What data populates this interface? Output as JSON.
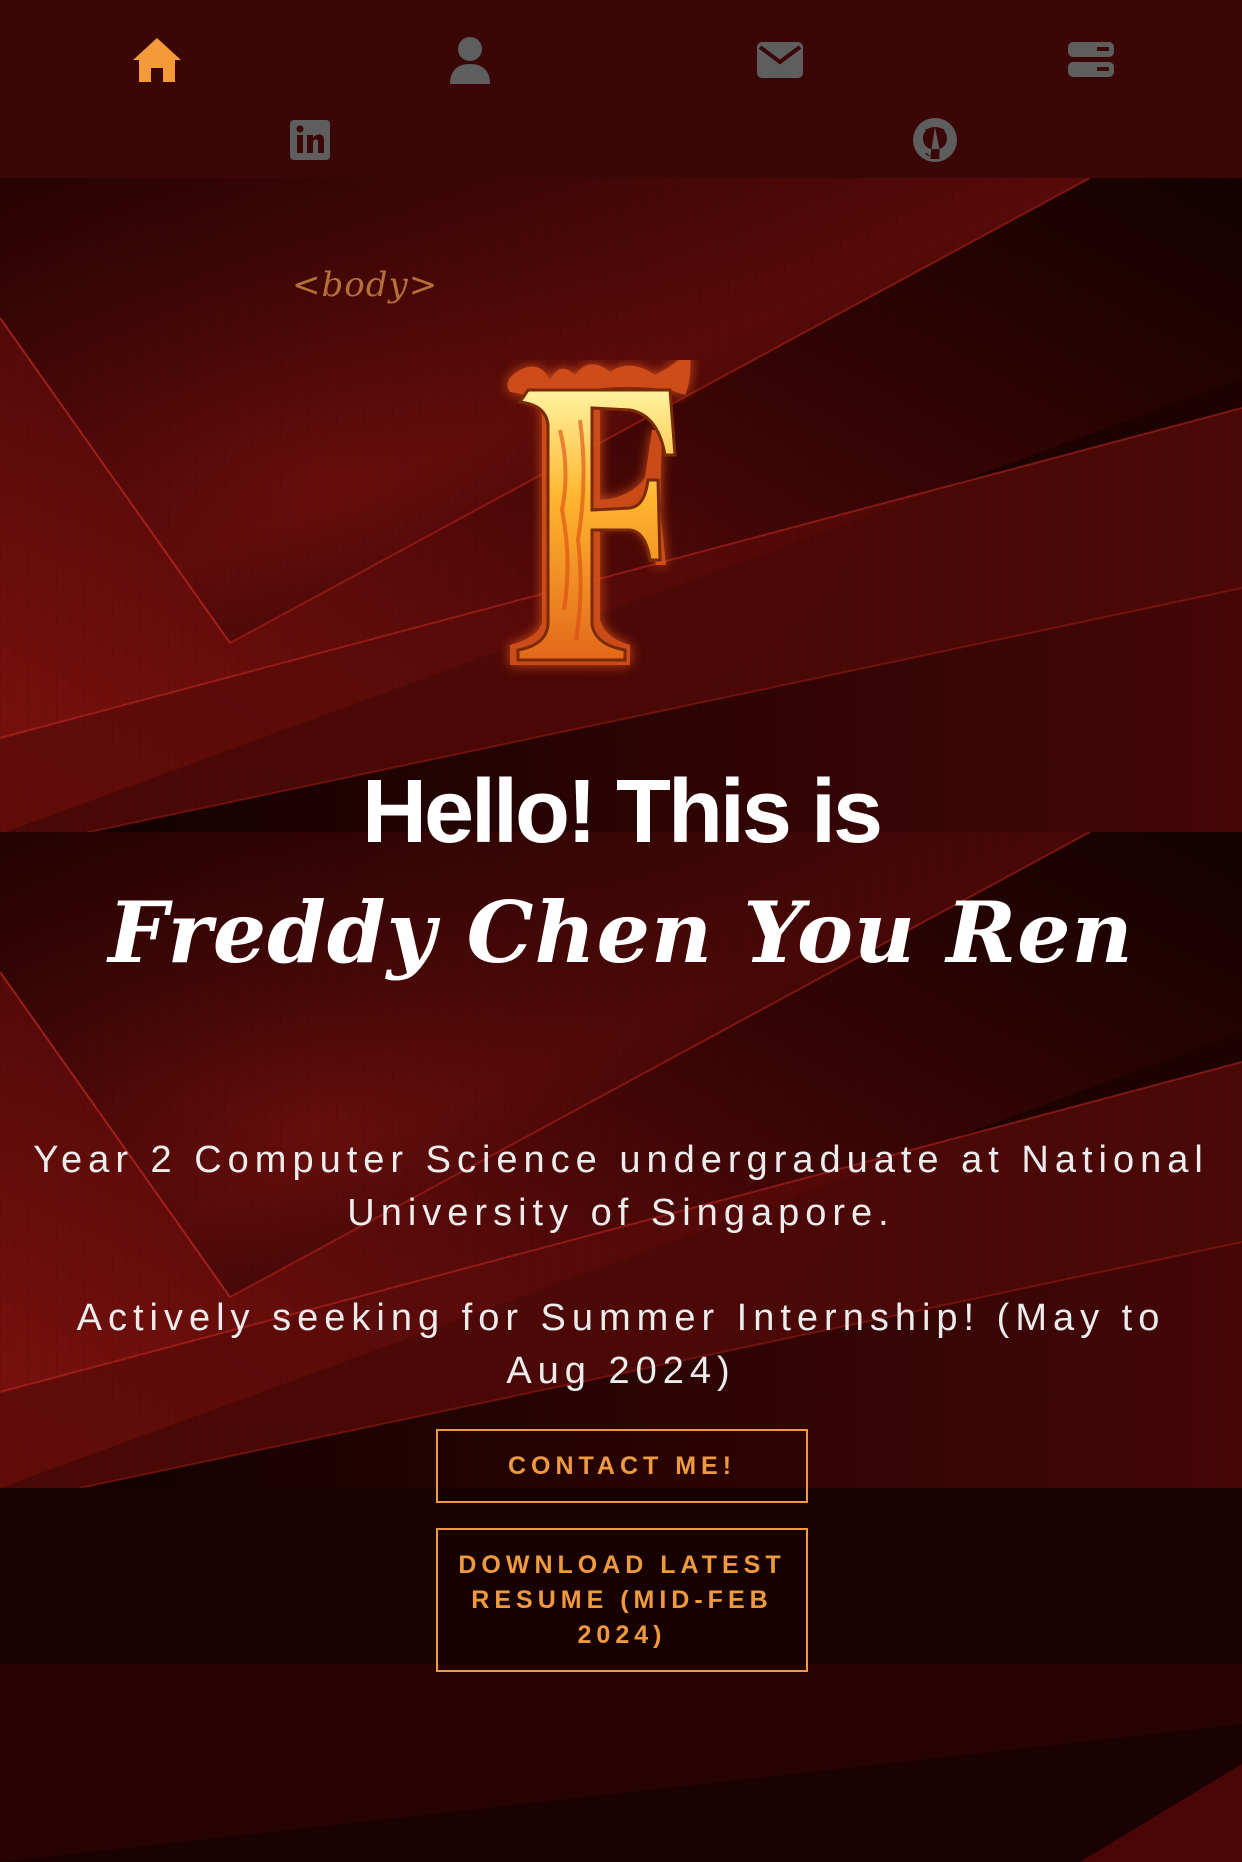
{
  "nav": {
    "active_color": "#f59a38",
    "inactive_color": "#5e5e5e",
    "items": [
      {
        "icon": "home-icon",
        "active": true
      },
      {
        "icon": "user-icon",
        "active": false
      },
      {
        "icon": "envelope-icon",
        "active": false
      },
      {
        "icon": "server-icon",
        "active": false
      },
      {
        "icon": "linkedin-icon",
        "active": false
      },
      {
        "icon": "github-icon",
        "active": false
      }
    ]
  },
  "hero": {
    "body_tag": "<body>",
    "logo_letter": "F",
    "greeting": "Hello! This is",
    "name": "Freddy Chen You Ren",
    "description_1": "Year 2 Computer Science undergraduate at National University of Singapore.",
    "description_2": "Actively seeking for Summer Internship! (May to Aug 2024)",
    "contact_button": "CONTACT ME!",
    "resume_button": "DOWNLOAD LATEST RESUME (MID-FEB 2024)"
  },
  "colors": {
    "accent": "#ef9a3e",
    "background": "#1a0203",
    "nav_background": "#3a0606"
  }
}
